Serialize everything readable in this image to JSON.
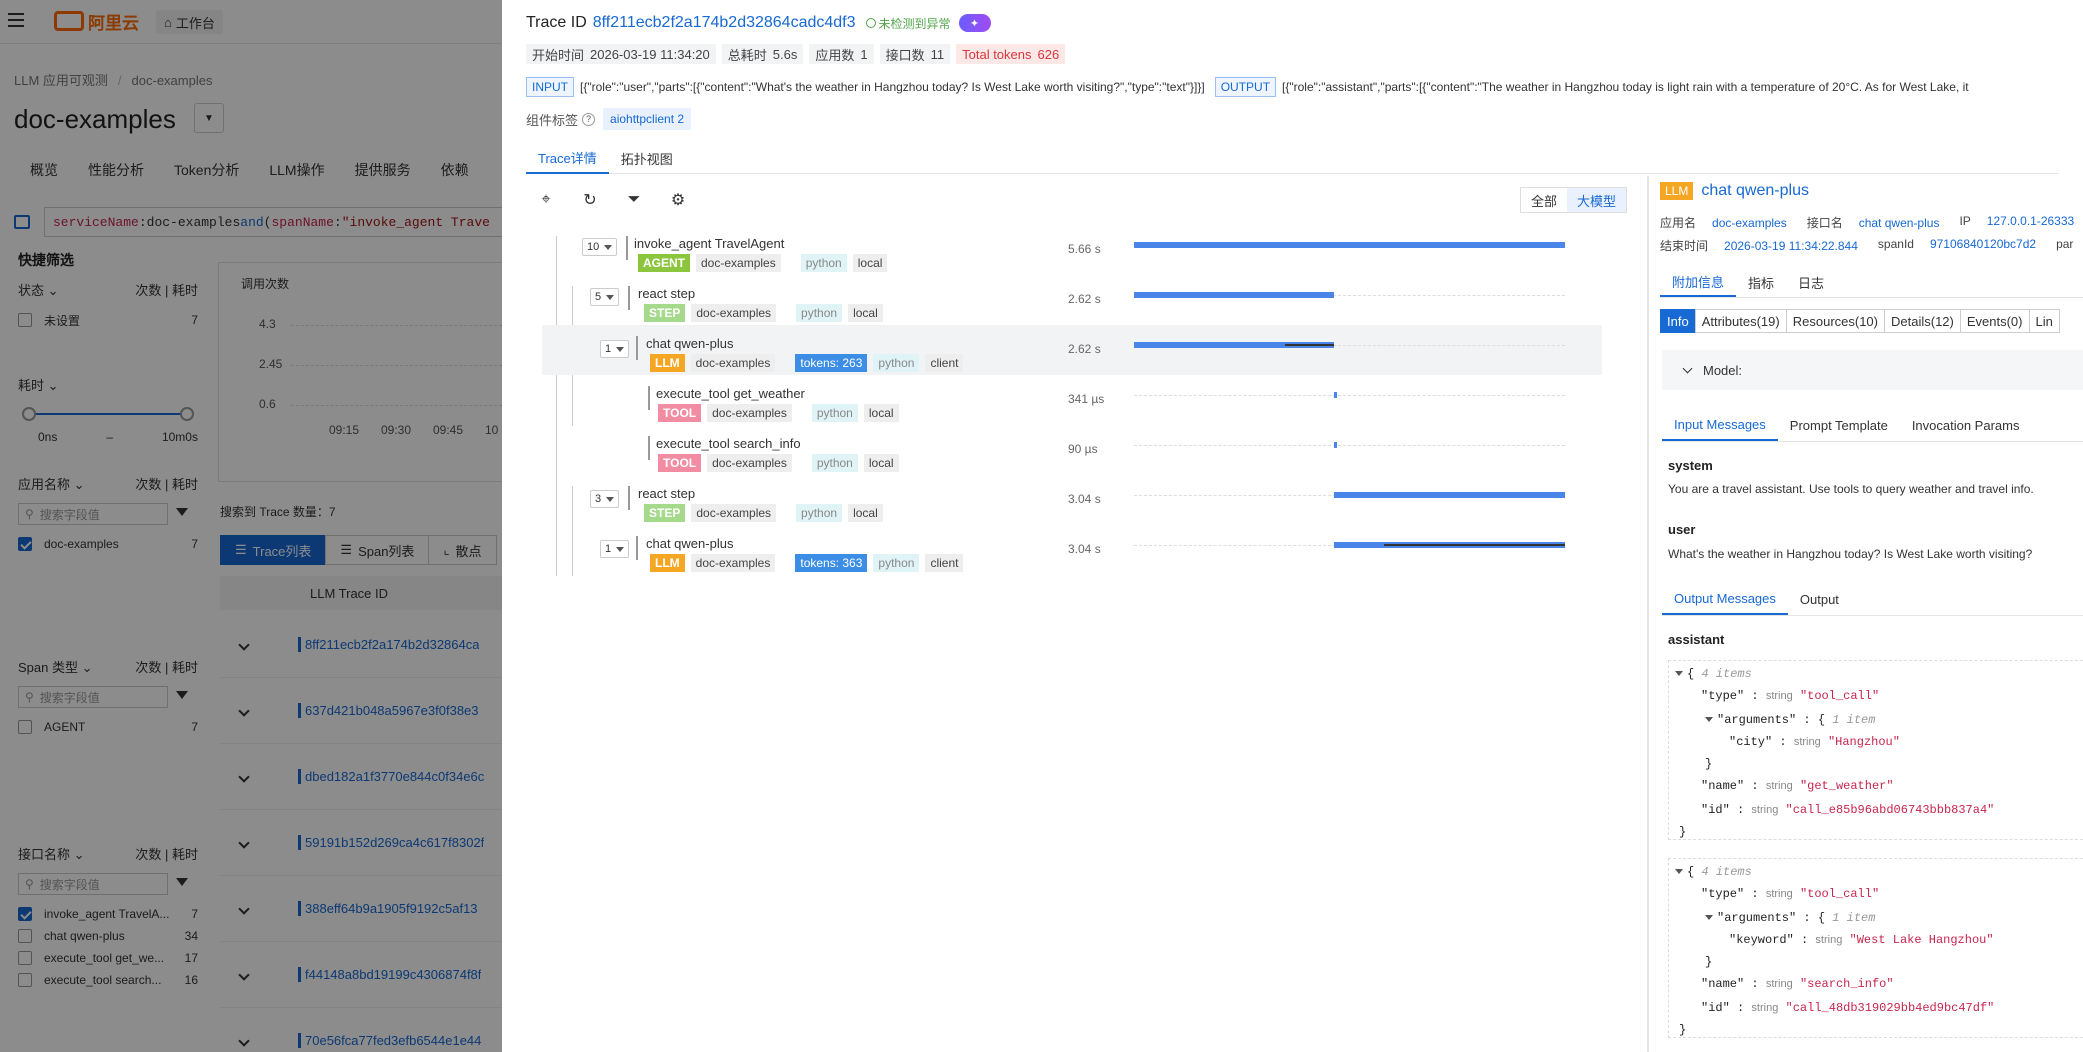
{
  "bg": {
    "logo": "阿里云",
    "workbench": "工作台",
    "breadcrumb": [
      "LLM 应用可观测",
      "doc-examples"
    ],
    "app_title": "doc-examples",
    "nav_tabs": [
      "概览",
      "性能分析",
      "Token分析",
      "LLM操作",
      "提供服务",
      "依赖"
    ],
    "query": {
      "k1": "serviceName",
      "op1": " : ",
      "v1": "doc-examples",
      "and": " and ",
      "paren": "(",
      "k2": "spanName",
      "op2": " : ",
      "v2": "\"invoke_agent Trave"
    },
    "quick_filter": "快捷筛选",
    "status_label": "状态",
    "count_label": "次数",
    "cost_label": "耗时",
    "unset": "未设置",
    "unset_count": "7",
    "cost_filter": "耗时",
    "slider_min": "0ns",
    "slider_dash": "–",
    "slider_max": "10m0s",
    "app_name_label": "应用名称",
    "search_placeholder": "搜索字段值",
    "app_items": [
      {
        "label": "doc-examples",
        "count": "7"
      }
    ],
    "span_type_label": "Span 类型",
    "span_items": [
      {
        "label": "AGENT",
        "count": "7"
      }
    ],
    "api_label": "接口名称",
    "api_items": [
      {
        "label": "invoke_agent TravelA...",
        "count": "7"
      },
      {
        "label": "chat qwen-plus",
        "count": "34"
      },
      {
        "label": "execute_tool get_we...",
        "count": "17"
      },
      {
        "label": "execute_tool search...",
        "count": "16"
      }
    ],
    "chart": {
      "title": "调用次数",
      "yticks": [
        "4.3",
        "2.45",
        "0.6"
      ],
      "xticks": [
        "09:15",
        "09:30",
        "09:45",
        "10"
      ]
    },
    "trace_count": "搜索到 Trace 数量：7",
    "list_tabs": [
      "Trace列表",
      "Span列表",
      "散点"
    ],
    "col_header": "LLM Trace ID",
    "rows": [
      "8ff211ecb2f2a174b2d32864ca",
      "637d421b048a5967e3f0f38e3",
      "dbed182a1f3770e844c0f34e6c",
      "59191b152d269ca4c617f8302f",
      "388eff64b9a1905f9192c5af13",
      "f44148a8bd19199c4306874f8f",
      "70e56fca77fed3efb6544e1e44"
    ]
  },
  "drawer": {
    "trace_label": "Trace ID",
    "trace_id": "8ff211ecb2f2a174b2d32864cadc4df3",
    "no_anomaly": "未检测到异常",
    "meta": [
      {
        "k": "开始时间",
        "v": "2026-03-19 11:34:20"
      },
      {
        "k": "总耗时",
        "v": "5.6s"
      },
      {
        "k": "应用数",
        "v": "1"
      },
      {
        "k": "接口数",
        "v": "11"
      },
      {
        "k": "Total tokens",
        "v": "626"
      }
    ],
    "input_tag": "INPUT",
    "input_text": "[{\"role\":\"user\",\"parts\":[{\"content\":\"What's the weather in Hangzhou today? Is West Lake worth visiting?\",\"type\":\"text\"}]}]",
    "output_tag": "OUTPUT",
    "output_text": "[{\"role\":\"assistant\",\"parts\":[{\"content\":\"The weather in Hangzhou today is light rain with a temperature of 20°C. As for West Lake, it",
    "component_label": "组件标签",
    "component_tag": "aiohttpclient 2",
    "tabs": [
      "Trace详情",
      "拓扑视图"
    ],
    "seg": [
      "全部",
      "大模型"
    ],
    "spans": [
      {
        "exp": "10",
        "name": "invoke_agent TravelAgent",
        "type": "AGENT",
        "svc": "doc-examples",
        "lang": "python",
        "kind": "local",
        "dur": "5.66 s"
      },
      {
        "exp": "5",
        "name": "react step",
        "type": "STEP",
        "svc": "doc-examples",
        "lang": "python",
        "kind": "local",
        "dur": "2.62 s"
      },
      {
        "exp": "1",
        "name": "chat qwen-plus",
        "type": "LLM",
        "svc": "doc-examples",
        "tokens": "tokens: 263",
        "lang": "python",
        "kind": "client",
        "dur": "2.62 s"
      },
      {
        "name": "execute_tool get_weather",
        "type": "TOOL",
        "svc": "doc-examples",
        "lang": "python",
        "kind": "local",
        "dur": "341 µs"
      },
      {
        "name": "execute_tool search_info",
        "type": "TOOL",
        "svc": "doc-examples",
        "lang": "python",
        "kind": "local",
        "dur": "90 µs"
      },
      {
        "exp": "3",
        "name": "react step",
        "type": "STEP",
        "svc": "doc-examples",
        "lang": "python",
        "kind": "local",
        "dur": "3.04 s"
      },
      {
        "exp": "1",
        "name": "chat qwen-plus",
        "type": "LLM",
        "svc": "doc-examples",
        "tokens": "tokens: 363",
        "lang": "python",
        "kind": "client",
        "dur": "3.04 s"
      }
    ]
  },
  "detail": {
    "badge": "LLM",
    "title": "chat qwen-plus",
    "app_label": "应用名",
    "app": "doc-examples",
    "api_label": "接口名",
    "api": "chat qwen-plus",
    "ip_label": "IP",
    "ip": "127.0.0.1-26333",
    "end_label": "结束时间",
    "end": "2026-03-19 11:34:22.844",
    "spanid_label": "spanId",
    "spanid": "97106840120bc7d2",
    "par": "par",
    "tabs": [
      "附加信息",
      "指标",
      "日志"
    ],
    "btns": [
      "Info",
      "Attributes(19)",
      "Resources(10)",
      "Details(12)",
      "Events(0)",
      "Lin"
    ],
    "model": "Model:",
    "in_tabs": [
      "Input Messages",
      "Prompt Template",
      "Invocation Params"
    ],
    "system_role": "system",
    "system_text": "You are a travel assistant. Use tools to query weather and travel info.",
    "user_role": "user",
    "user_text": "What's the weather in Hangzhou today? Is West Lake worth visiting?",
    "out_tabs": [
      "Output Messages",
      "Output"
    ],
    "assistant_role": "assistant",
    "items4": "4 items",
    "item1": "1 item",
    "type_key": "\"type\"",
    "string": "string",
    "tool_call": "\"tool_call\"",
    "arguments_key": "\"arguments\"",
    "city_key": "\"city\"",
    "city_val": "\"Hangzhou\"",
    "name_key": "\"name\"",
    "name1": "\"get_weather\"",
    "id_key": "\"id\"",
    "id1": "\"call_e85b96abd06743bbb837a4\"",
    "keyword_key": "\"keyword\"",
    "keyword_val": "\"West Lake Hangzhou\"",
    "name2": "\"search_info\"",
    "id2": "\"call_48db319029bb4ed9bc47df\""
  }
}
